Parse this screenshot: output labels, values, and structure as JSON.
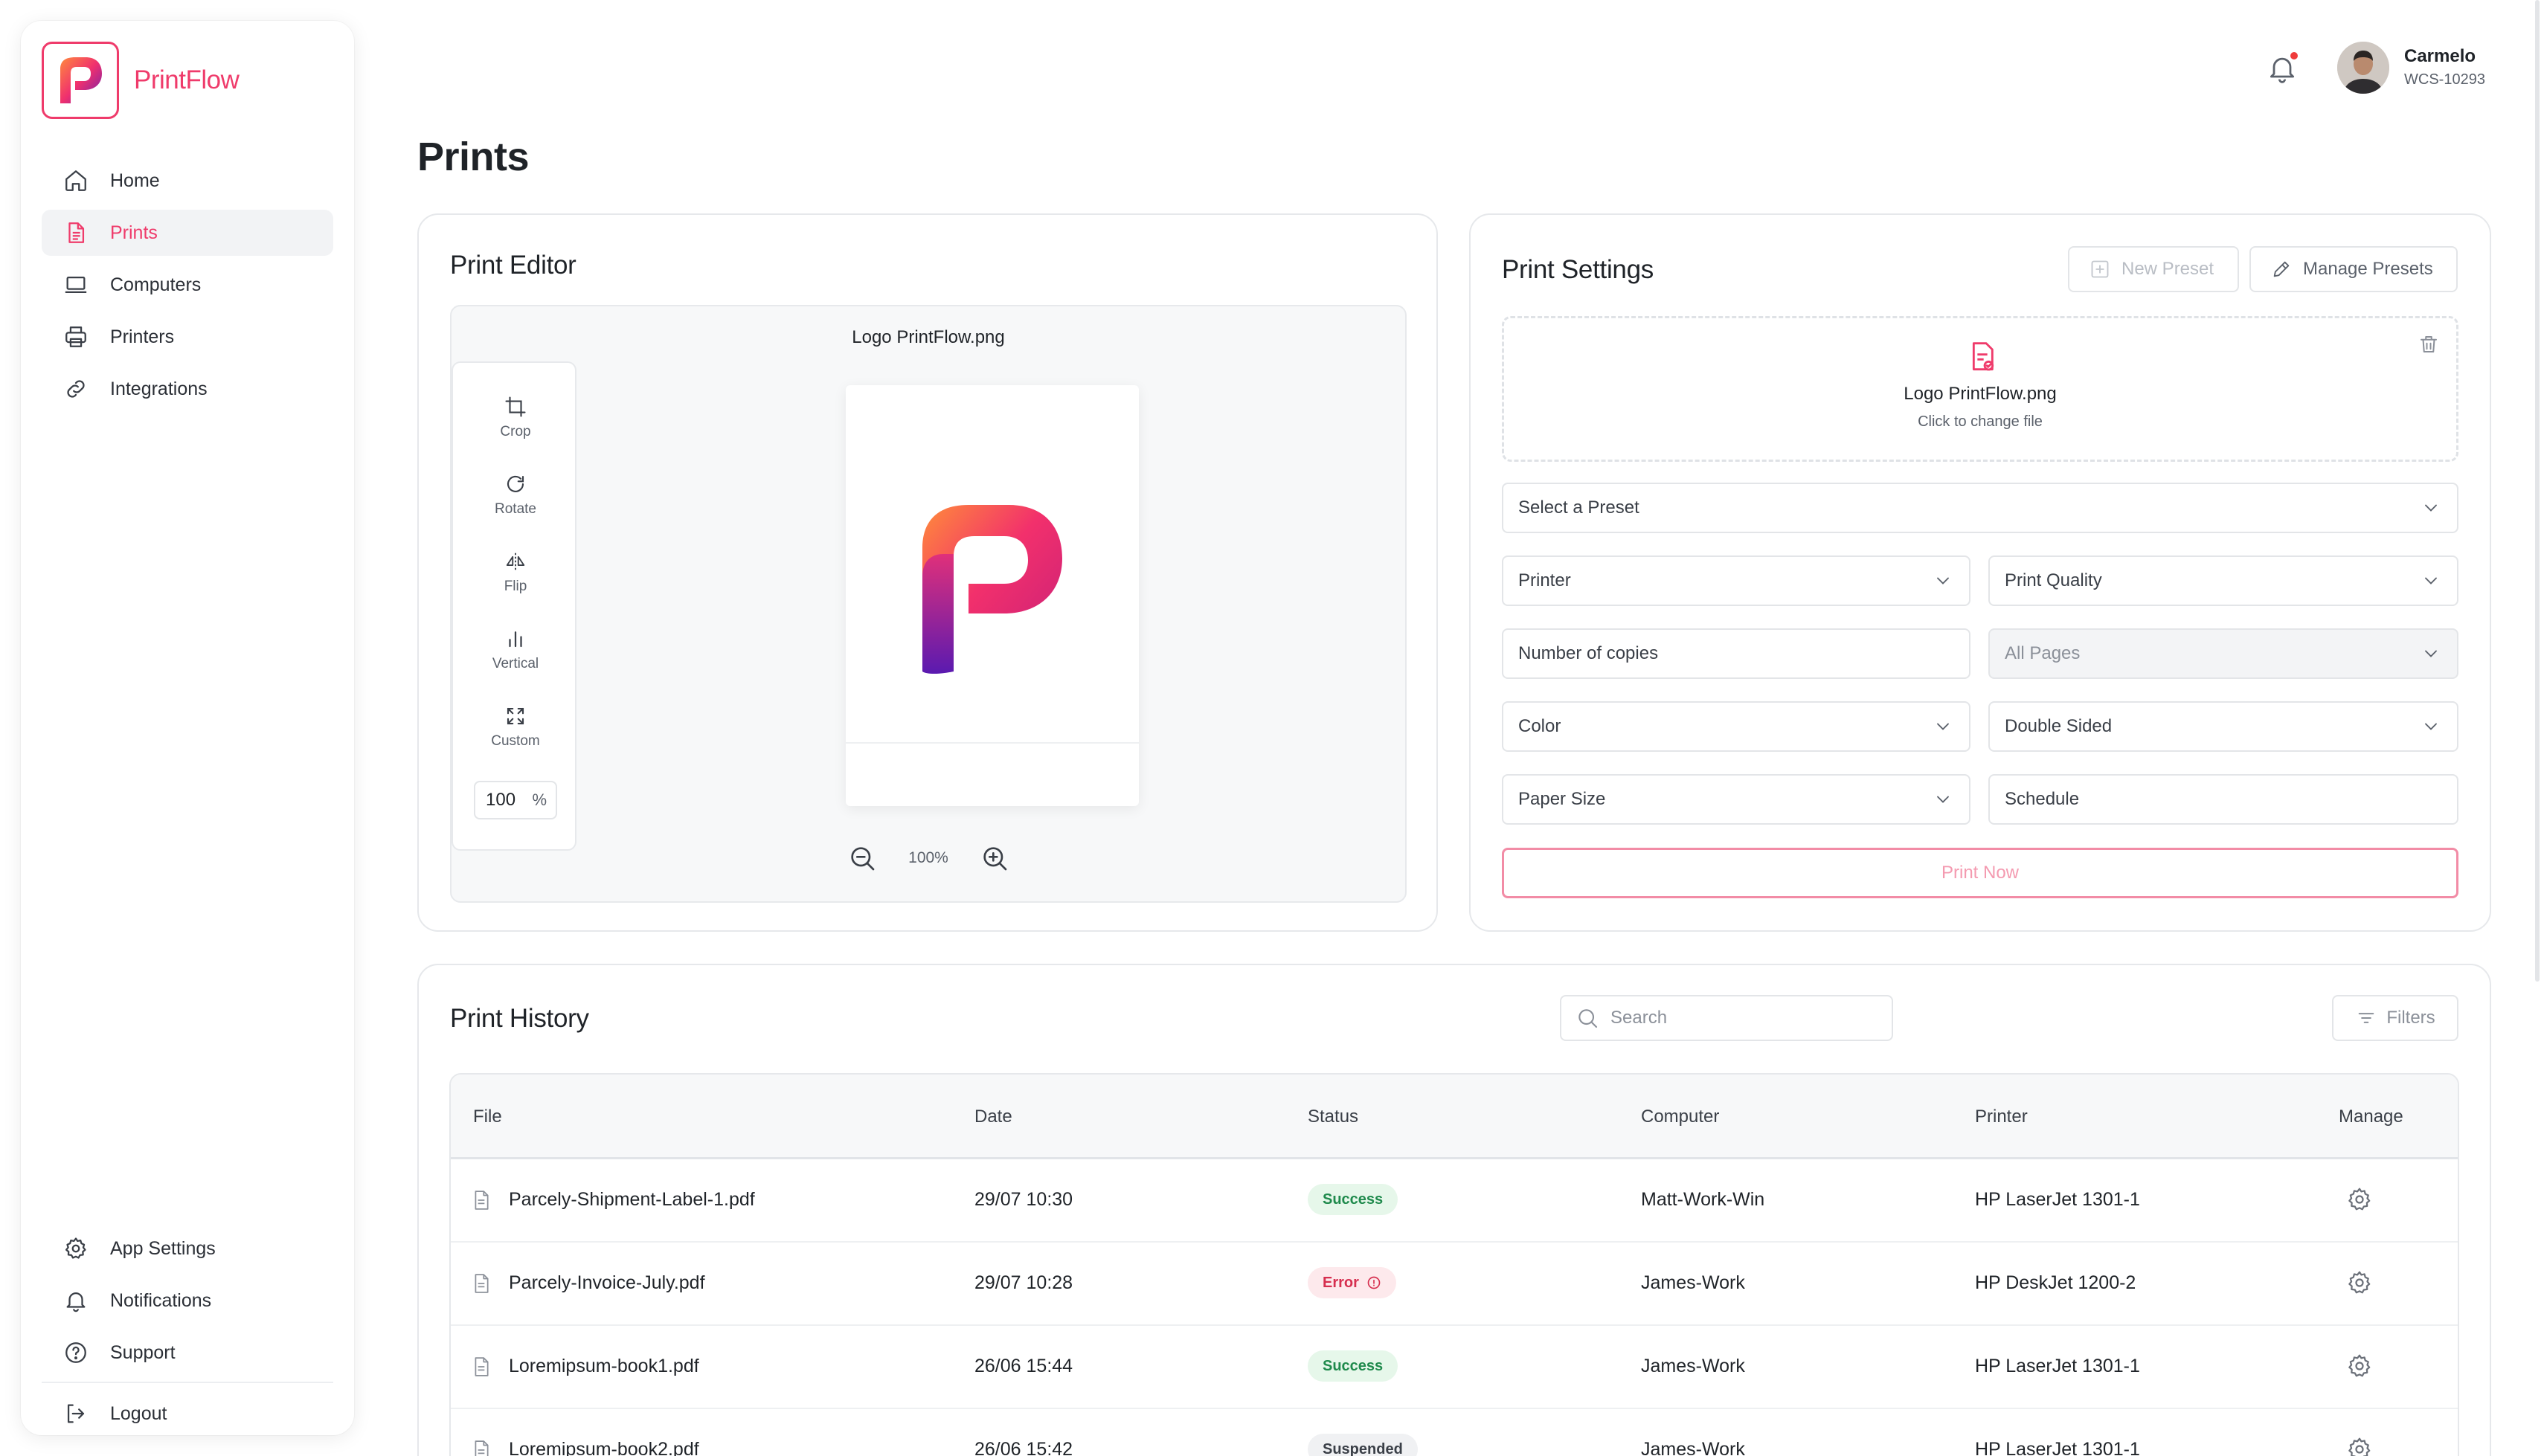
{
  "app": {
    "brand": "PrintFlow",
    "accent_color": "#ef3b6b"
  },
  "sidebar": {
    "items": [
      {
        "label": "Home",
        "icon": "home-icon"
      },
      {
        "label": "Prints",
        "icon": "document-icon",
        "active": true
      },
      {
        "label": "Computers",
        "icon": "laptop-icon"
      },
      {
        "label": "Printers",
        "icon": "printer-icon"
      },
      {
        "label": "Integrations",
        "icon": "link-icon"
      }
    ],
    "bottom_items": [
      {
        "label": "App Settings",
        "icon": "gear-icon"
      },
      {
        "label": "Notifications",
        "icon": "bell-icon"
      },
      {
        "label": "Support",
        "icon": "help-icon"
      },
      {
        "label": "Logout",
        "icon": "logout-icon"
      }
    ]
  },
  "user": {
    "name": "Carmelo",
    "id": "WCS-10293",
    "has_notification": true
  },
  "page": {
    "title": "Prints"
  },
  "editor": {
    "title": "Print Editor",
    "file_name": "Logo PrintFlow.png",
    "tools": [
      {
        "label": "Crop",
        "icon": "crop-icon"
      },
      {
        "label": "Rotate",
        "icon": "rotate-icon"
      },
      {
        "label": "Flip",
        "icon": "flip-icon"
      },
      {
        "label": "Vertical",
        "icon": "vertical-bars-icon"
      },
      {
        "label": "Custom",
        "icon": "expand-icon"
      }
    ],
    "scale_value": "100",
    "scale_unit": "%",
    "zoom_level": "100%"
  },
  "settings": {
    "title": "Print Settings",
    "new_preset_label": "New Preset",
    "manage_presets_label": "Manage Presets",
    "file_name": "Logo PrintFlow.png",
    "change_file_hint": "Click to change file",
    "preset_placeholder": "Select a Preset",
    "printer_placeholder": "Printer",
    "quality_placeholder": "Print Quality",
    "copies_placeholder": "Number of copies",
    "pages_value": "All Pages",
    "color_placeholder": "Color",
    "sided_value": "Double Sided",
    "paper_size_placeholder": "Paper Size",
    "schedule_placeholder": "Schedule",
    "print_now_label": "Print Now"
  },
  "history": {
    "title": "Print History",
    "search_placeholder": "Search",
    "filters_label": "Filters",
    "columns": [
      "File",
      "Date",
      "Status",
      "Computer",
      "Printer",
      "Manage"
    ],
    "rows": [
      {
        "file": "Parcely-Shipment-Label-1.pdf",
        "date": "29/07 10:30",
        "status": "Success",
        "status_type": "success",
        "computer": "Matt-Work-Win",
        "printer": "HP LaserJet 1301-1"
      },
      {
        "file": "Parcely-Invoice-July.pdf",
        "date": "29/07 10:28",
        "status": "Error",
        "status_type": "error",
        "computer": "James-Work",
        "printer": "HP DeskJet 1200-2"
      },
      {
        "file": "Loremipsum-book1.pdf",
        "date": "26/06 15:44",
        "status": "Success",
        "status_type": "success",
        "computer": "James-Work",
        "printer": "HP LaserJet 1301-1"
      },
      {
        "file": "Loremipsum-book2.pdf",
        "date": "26/06 15:42",
        "status": "Suspended",
        "status_type": "suspended",
        "computer": "James-Work",
        "printer": "HP LaserJet 1301-1"
      }
    ]
  }
}
